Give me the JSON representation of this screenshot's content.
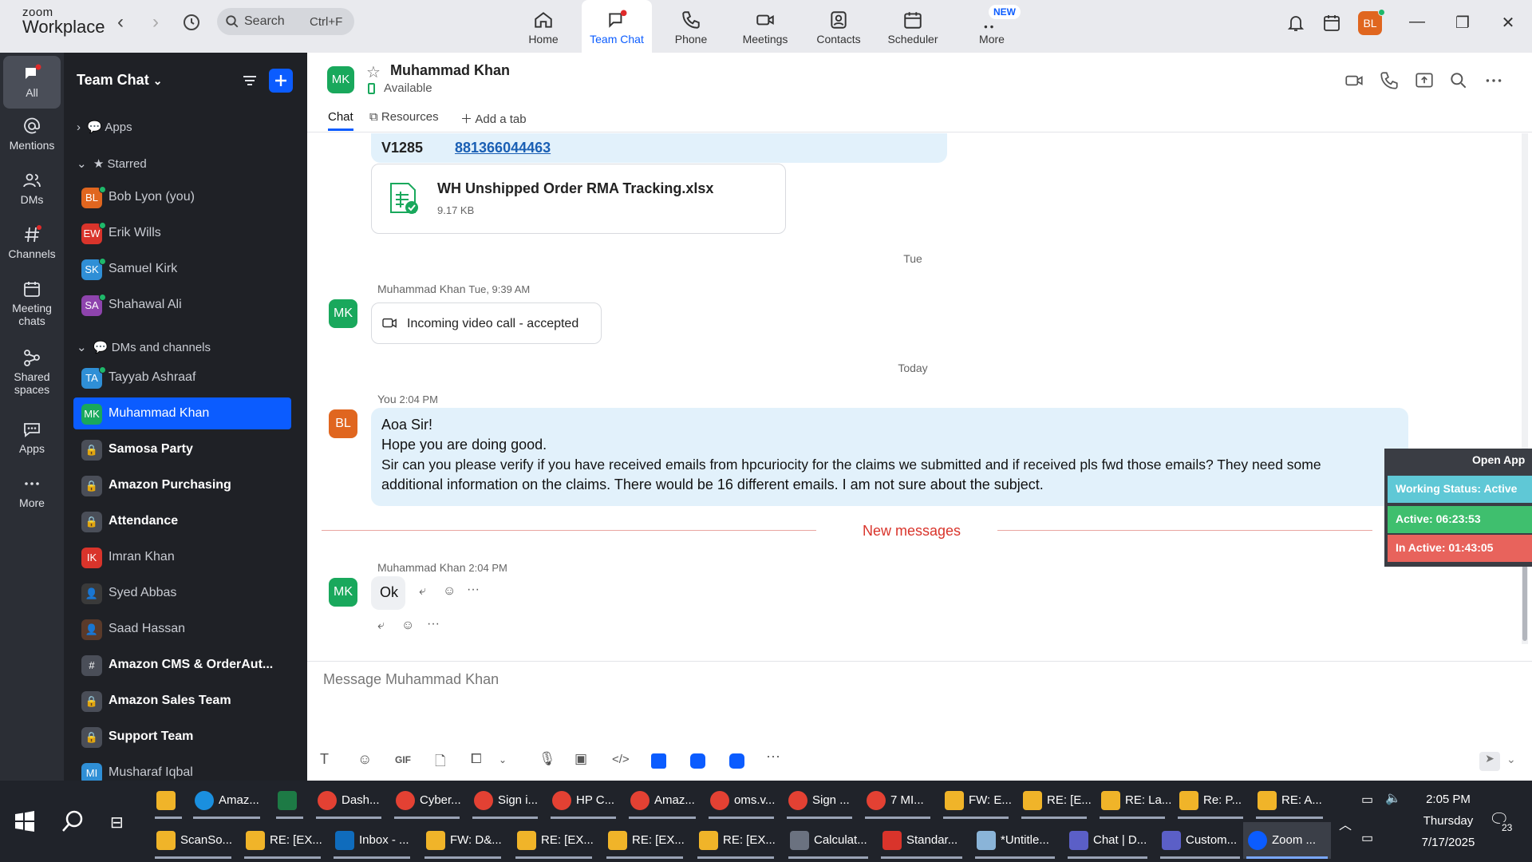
{
  "app": {
    "logo_line1": "zoom",
    "logo_line2": "Workplace"
  },
  "topbar": {
    "search_placeholder": "Search",
    "search_shortcut": "Ctrl+F",
    "tabs": [
      {
        "label": "Home",
        "icon": "home-icon"
      },
      {
        "label": "Team Chat",
        "icon": "chat-icon"
      },
      {
        "label": "Phone",
        "icon": "phone-icon"
      },
      {
        "label": "Meetings",
        "icon": "video-icon"
      },
      {
        "label": "Contacts",
        "icon": "contacts-icon"
      },
      {
        "label": "Scheduler",
        "icon": "calendar-icon"
      },
      {
        "label": "More",
        "icon": "more-icon"
      }
    ],
    "new_badge": "NEW",
    "user_initials": "BL"
  },
  "rail": [
    {
      "label": "All",
      "icon": "chat-icon"
    },
    {
      "label": "Mentions",
      "icon": "at-icon"
    },
    {
      "label": "DMs",
      "icon": "people-icon"
    },
    {
      "label": "Channels",
      "icon": "hash-icon"
    },
    {
      "label": "Meeting chats",
      "icon": "calendar-icon"
    },
    {
      "label": "Shared spaces",
      "icon": "share-icon"
    },
    {
      "label": "Apps",
      "icon": "apps-icon"
    },
    {
      "label": "More",
      "icon": "more-icon"
    }
  ],
  "side": {
    "title": "Team Chat",
    "sections": {
      "apps": "Apps",
      "starred": "Starred",
      "dms": "DMs and channels"
    },
    "starred": [
      {
        "initials": "BL",
        "name": "Bob Lyon (you)",
        "color": "#e0661f"
      },
      {
        "initials": "EW",
        "name": "Erik Wills",
        "color": "#d9342b"
      },
      {
        "initials": "SK",
        "name": "Samuel Kirk",
        "color": "#2f8fd6"
      },
      {
        "initials": "SA",
        "name": "Shahawal Ali",
        "color": "#8e44ad"
      }
    ],
    "channels": [
      {
        "initials": "TA",
        "name": "Tayyab Ashraaf",
        "color": "#2f8fd6",
        "bold": false
      },
      {
        "initials": "MK",
        "name": "Muhammad Khan",
        "color": "#19a85c",
        "bold": false
      },
      {
        "initials": "",
        "name": "Samosa Party",
        "color": "#4a4e58",
        "bold": true
      },
      {
        "initials": "",
        "name": "Amazon Purchasing",
        "color": "#4a4e58",
        "bold": true
      },
      {
        "initials": "",
        "name": "Attendance",
        "color": "#4a4e58",
        "bold": true
      },
      {
        "initials": "IK",
        "name": "Imran Khan",
        "color": "#d9342b",
        "bold": false
      },
      {
        "initials": "",
        "name": "Syed Abbas",
        "color": "#333",
        "bold": false
      },
      {
        "initials": "",
        "name": "Saad Hassan",
        "color": "#5a3a2a",
        "bold": false
      },
      {
        "initials": "#",
        "name": "Amazon CMS & OrderAut...",
        "color": "#4a4e58",
        "bold": true
      },
      {
        "initials": "",
        "name": "Amazon Sales Team",
        "color": "#4a4e58",
        "bold": true
      },
      {
        "initials": "",
        "name": "Support Team",
        "color": "#4a4e58",
        "bold": true
      },
      {
        "initials": "MI",
        "name": "Musharaf Iqbal",
        "color": "#2f8fd6",
        "bold": false
      }
    ]
  },
  "chat": {
    "name": "Muhammad Khan",
    "initials": "MK",
    "status": "Available",
    "tabs": {
      "chat": "Chat",
      "resources": "Resources",
      "add": "Add a tab"
    },
    "partial_code": "V1285",
    "partial_link": "881366044463",
    "file_name": "WH Unshipped Order RMA Tracking.xlsx",
    "file_size": "9.17 KB",
    "date_tue": "Tue",
    "msg1_sender": "Muhammad Khan",
    "msg1_time": "Tue, 9:39 AM",
    "msg1_text": "Incoming video call - accepted",
    "date_today": "Today",
    "msg2_sender": "You",
    "msg2_time": "2:04 PM",
    "msg2_initials": "BL",
    "msg2_lines": [
      "Aoa Sir!",
      "Hope you are doing good.",
      "Sir can you please verify if you have received emails from hpcuriocity for the claims we submitted and if received pls fwd those emails? They need some",
      "additional information on the claims. There would be 16 different emails. I am not sure about the subject."
    ],
    "new_messages": "New messages",
    "msg3_sender": "Muhammad Khan",
    "msg3_time": "2:04 PM",
    "msg3_text": "Ok",
    "composer_placeholder": "Message Muhammad Khan"
  },
  "widget": {
    "open_app": "Open App",
    "working": "Working Status: Active",
    "active": "Active: 06:23:53",
    "inactive": "In Active: 01:43:05"
  },
  "taskbar": {
    "row1": [
      "Amaz...",
      "Dash...",
      "Cyber...",
      "Sign i...",
      "HP C...",
      "Amaz...",
      "oms.v...",
      "Sign ...",
      "7 MI...",
      "FW: E...",
      "RE: [E...",
      "RE: La...",
      "Re: P...",
      "RE: A..."
    ],
    "row2": [
      "ScanSo...",
      "RE: [EX...",
      "Inbox - ...",
      "FW: D&...",
      "RE: [EX...",
      "RE: [EX...",
      "RE: [EX...",
      "Calculat...",
      "Standar...",
      "*Untitle...",
      "Chat | D...",
      "Custom...",
      "Zoom ..."
    ],
    "time": "2:05 PM",
    "day": "Thursday",
    "date": "7/17/2025",
    "notif_count": "23"
  }
}
